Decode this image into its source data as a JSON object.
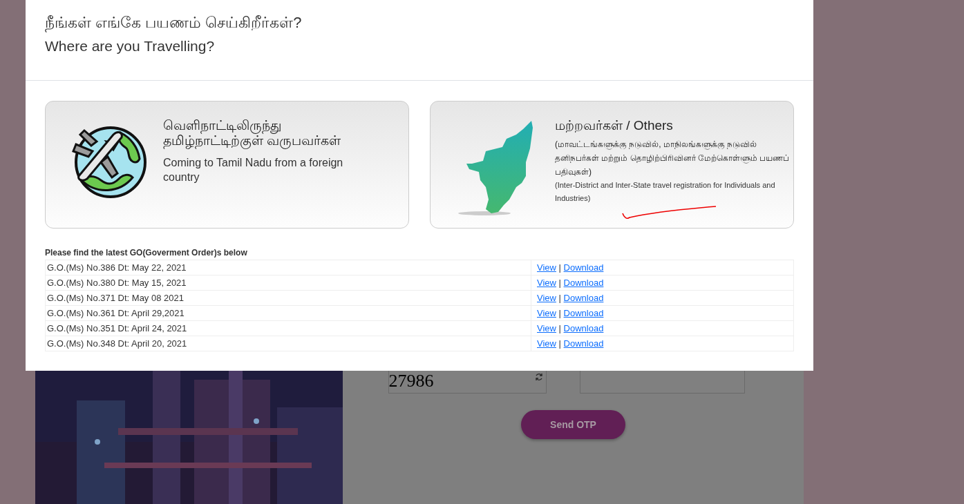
{
  "modal": {
    "title": "நீங்கள் எங்கே பயணம் செய்கிறீர்கள்?",
    "subtitle": "Where are you Travelling?",
    "options": [
      {
        "kind": "foreign",
        "title": "வெளிநாட்டிலிருந்து\nதமிழ்நாட்டிற்குள் வருபவர்கள்",
        "description": "Coming to Tamil Nadu from a foreign country"
      },
      {
        "kind": "others",
        "title": "மற்றவர்கள் / Others",
        "tamil_note": "(மாவட்டங்களுக்கு நடுவில், மாநிலங்களுக்கு நடுவில் தனிநபர்கள் மற்றும் தொழிற்பிரிவினர் மேற்கொள்ளும் பயணப் பதிவுகள்)",
        "english_note": "(Inter-District and Inter-State travel registration for Individuals and Industries)"
      }
    ],
    "go_heading": "Please find the latest GO(Goverment Order)s below",
    "go_rows": [
      {
        "title": "G.O.(Ms) No.386 Dt: May 22, 2021",
        "view": "View",
        "separator": "|",
        "download": "Download"
      },
      {
        "title": "G.O.(Ms) No.380 Dt: May 15, 2021",
        "view": "View",
        "separator": "|",
        "download": "Download"
      },
      {
        "title": "G.O.(Ms) No.371 Dt: May 08 2021",
        "view": "View",
        "separator": "|",
        "download": "Download"
      },
      {
        "title": "G.O.(Ms) No.361 Dt: April 29,2021",
        "view": "View",
        "separator": "|",
        "download": "Download"
      },
      {
        "title": "G.O.(Ms) No.351 Dt: April 24, 2021",
        "view": "View",
        "separator": "|",
        "download": "Download"
      },
      {
        "title": "G.O.(Ms) No.348 Dt: April 20, 2021",
        "view": "View",
        "separator": "|",
        "download": "Download"
      }
    ]
  },
  "background_form": {
    "captcha": "27986",
    "button": "Send OTP"
  }
}
